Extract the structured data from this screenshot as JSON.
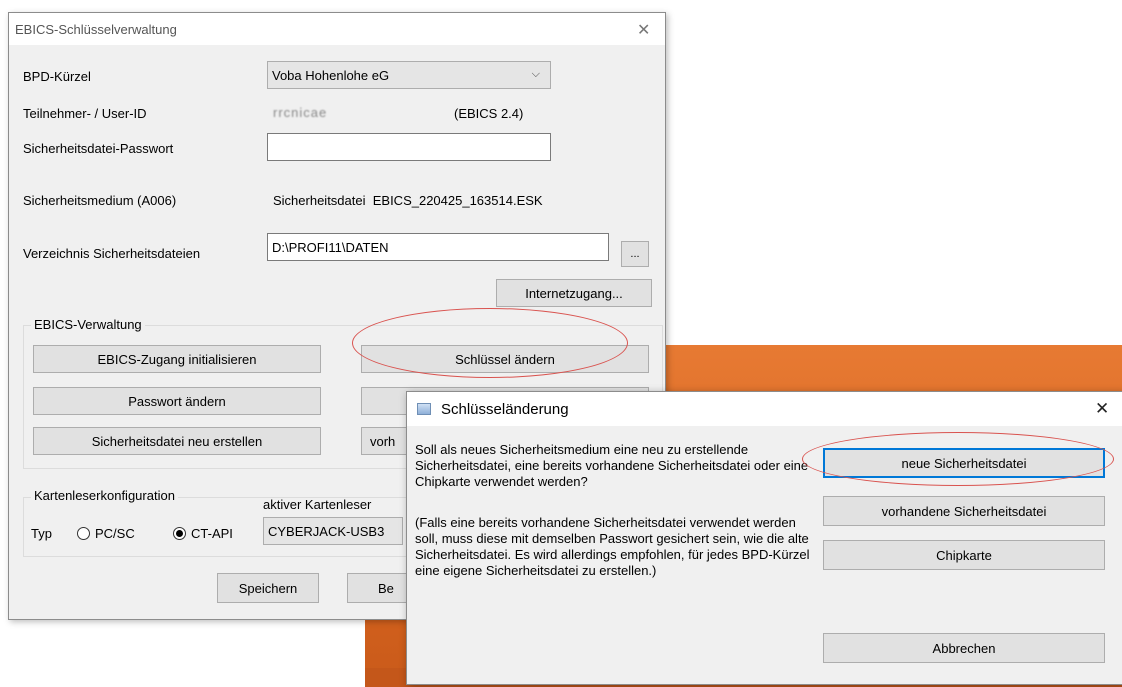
{
  "main_window": {
    "title": "EBICS-Schlüsselverwaltung",
    "close_glyph": "✕",
    "bpd_label": "BPD-Kürzel",
    "bpd_value": "Voba Hohenlohe eG",
    "userid_label": "Teilnehmer- / User-ID",
    "userid_value": "rrcnicae",
    "ebics_version": "(EBICS 2.4)",
    "password_label": "Sicherheitsdatei-Passwort",
    "password_value": "",
    "medium_label": "Sicherheitsmedium (A006)",
    "medium_value": "Sicherheitsdatei  EBICS_220425_163514.ESK",
    "dir_label": "Verzeichnis Sicherheitsdateien",
    "dir_value": "D:\\PROFI11\\DATEN",
    "browse_label": "...",
    "internet_button": "Internetzugang...",
    "ebics_group": {
      "title": "EBICS-Verwaltung",
      "init_button": "EBICS-Zugang initialisieren",
      "change_key_button": "Schlüssel ändern",
      "change_password_button": "Passwort ändern",
      "recreate_file_button": "Sicherheitsdatei neu erstellen",
      "existing_button_partial": "vorh"
    },
    "card_group": {
      "title": "Kartenleserkonfiguration",
      "type_label": "Typ",
      "option_pcsc": "PC/SC",
      "option_ctapi": "CT-API",
      "active_reader_label": "aktiver Kartenleser",
      "active_reader_value": "CYBERJACK-USB3"
    },
    "save_button": "Speichern",
    "second_button_partial": "Be"
  },
  "dialog": {
    "title": "Schlüsseländerung",
    "close_glyph": "✕",
    "question": "Soll als neues Sicherheitsmedium eine neu zu erstellende Sicherheitsdatei, eine bereits vorhandene Sicherheitsdatei oder eine Chipkarte verwendet werden?",
    "hint": "(Falls eine bereits vorhandene Sicherheitsdatei verwendet werden soll, muss diese mit demselben Passwort gesichert sein, wie die alte Sicherheitsdatei. Es wird allerdings empfohlen, für jedes BPD-Kürzel eine eigene Sicherheitsdatei zu erstellen.)",
    "new_file_button": "neue Sicherheitsdatei",
    "existing_file_button": "vorhandene Sicherheitsdatei",
    "chipcard_button": "Chipkarte",
    "cancel_button": "Abbrechen"
  },
  "colors": {
    "window_bg": "#f0f0f0",
    "desktop_orange": "#e2722a",
    "highlight_red": "#d9534f",
    "focus_blue": "#0078d7"
  }
}
